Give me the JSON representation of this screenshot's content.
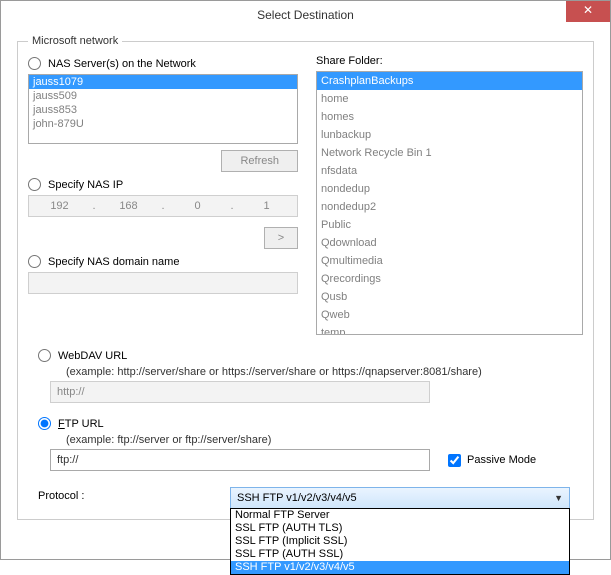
{
  "window": {
    "title": "Select Destination"
  },
  "network": {
    "legend": "Microsoft network",
    "nas_radio_label": "NAS Server(s) on the Network",
    "nas_items": [
      "jauss1079",
      "jauss509",
      "jauss853",
      "john-879U"
    ],
    "nas_selected": "jauss1079",
    "refresh_label": "Refresh",
    "ip_radio_label": "Specify NAS IP",
    "ip": {
      "o1": "192",
      "o2": "168",
      "o3": "0",
      "o4": "1"
    },
    "go_label": ">",
    "domain_radio_label": "Specify NAS domain name",
    "share_label": "Share Folder:",
    "share_items": [
      "CrashplanBackups",
      "home",
      "homes",
      "lunbackup",
      "Network Recycle Bin 1",
      "nfsdata",
      "nondedup",
      "nondedup2",
      "Public",
      "Qdownload",
      "Qmultimedia",
      "Qrecordings",
      "Qusb",
      "Qweb",
      "temp"
    ],
    "share_selected": "CrashplanBackups"
  },
  "webdav": {
    "radio_label": "WebDAV URL",
    "example": "(example: http://server/share or https://server/share or https://qnapserver:8081/share)",
    "value": "http://"
  },
  "ftp": {
    "radio_label_prefix": "F",
    "radio_label_rest": "TP URL",
    "example": "(example: ftp://server or ftp://server/share)",
    "value": "ftp://",
    "passive_label": "Passive Mode"
  },
  "protocol": {
    "label": "Protocol :",
    "selected": "SSH FTP v1/v2/v3/v4/v5",
    "options": [
      "Normal FTP Server",
      "SSL FTP (AUTH TLS)",
      "SSL FTP (Implicit SSL)",
      "SSL FTP (AUTH SSL)",
      "SSH FTP v1/v2/v3/v4/v5"
    ]
  }
}
